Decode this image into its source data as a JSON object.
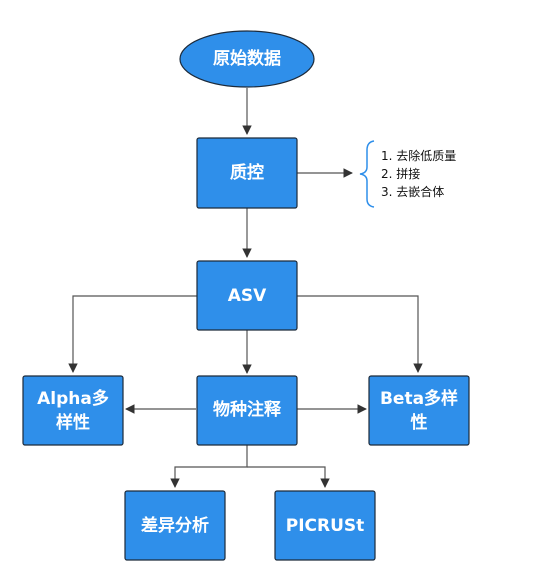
{
  "nodes": {
    "raw_data": "原始数据",
    "qc": "质控",
    "asv": "ASV",
    "alpha": [
      "Alpha多",
      "样性"
    ],
    "taxonomy": "物种注释",
    "beta": [
      "Beta多样",
      "性"
    ],
    "diff": "差异分析",
    "picrust": "PICRUSt"
  },
  "qc_steps": [
    "1. 去除低质量",
    "2. 拼接",
    "3. 去嵌合体"
  ],
  "colors": {
    "node_fill": "#2f8fea",
    "node_stroke": "#1c2a3a",
    "edge": "#555555",
    "text": "#ffffff"
  }
}
